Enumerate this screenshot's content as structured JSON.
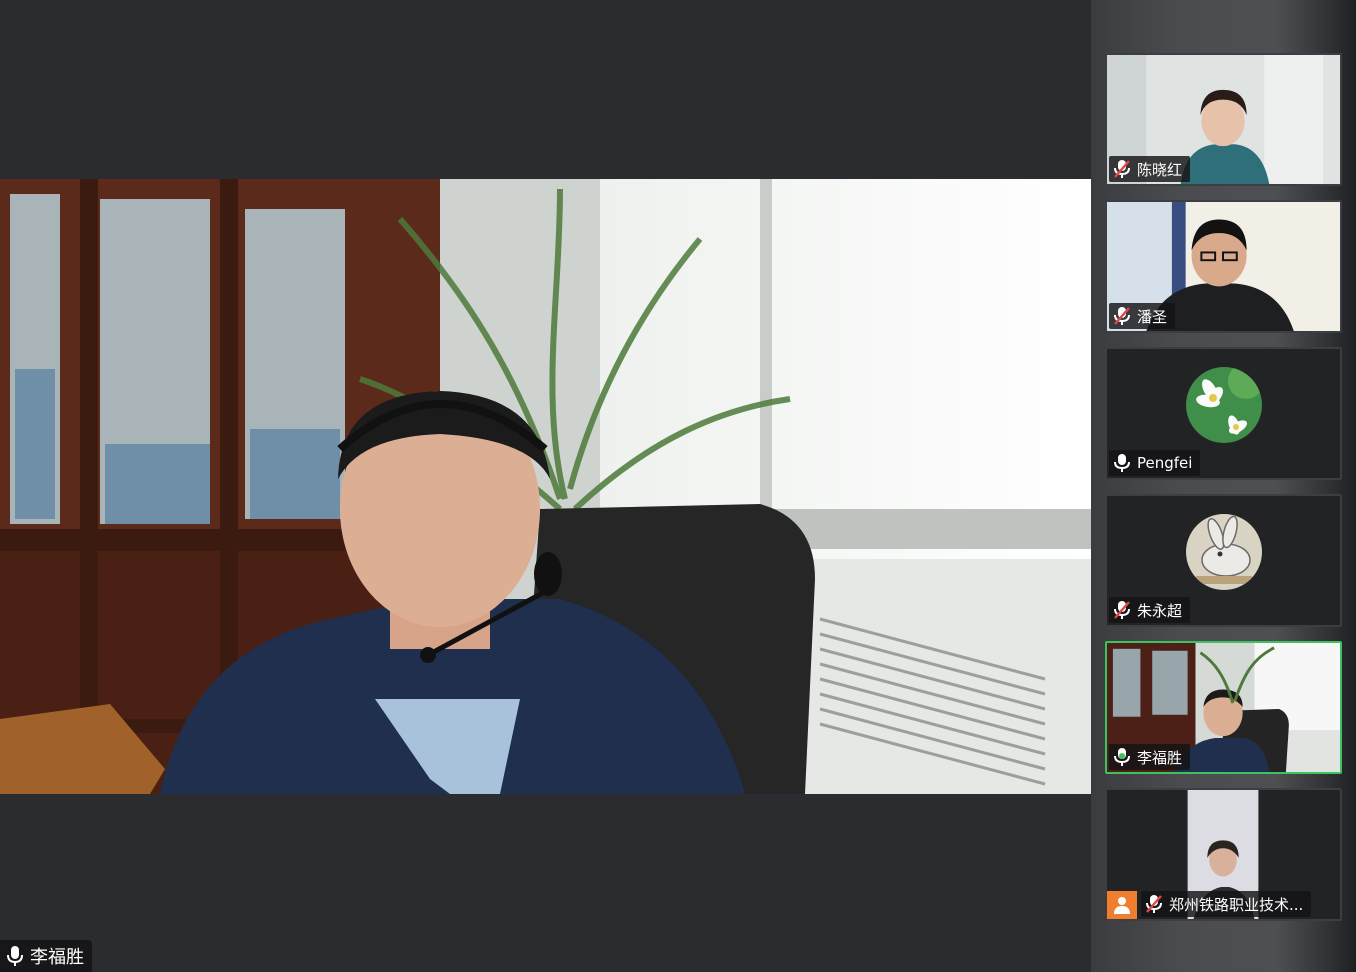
{
  "meeting": {
    "active_speaker": {
      "name": "李福胜",
      "mic": "on"
    }
  },
  "participants": [
    {
      "name": "陈晓红",
      "mic": "muted",
      "video": "camera"
    },
    {
      "name": "潘圣",
      "mic": "muted",
      "video": "camera"
    },
    {
      "name": "Pengfei",
      "mic": "on",
      "video": "avatar-flowers"
    },
    {
      "name": "朱永超",
      "mic": "muted",
      "video": "avatar-rabbit"
    },
    {
      "name": "李福胜",
      "mic": "on",
      "video": "camera",
      "active": true
    },
    {
      "name": "郑州铁路职业技术...",
      "mic": "muted",
      "video": "camera",
      "host": true
    }
  ],
  "colors": {
    "background": "#2a2c2f",
    "active_border": "#3cc35f",
    "host_badge": "#ef7f2e",
    "muted_icon": "#e04646"
  },
  "icons": {
    "mic_on": "microphone-icon",
    "mic_muted": "microphone-muted-icon",
    "host": "host-person-icon"
  }
}
